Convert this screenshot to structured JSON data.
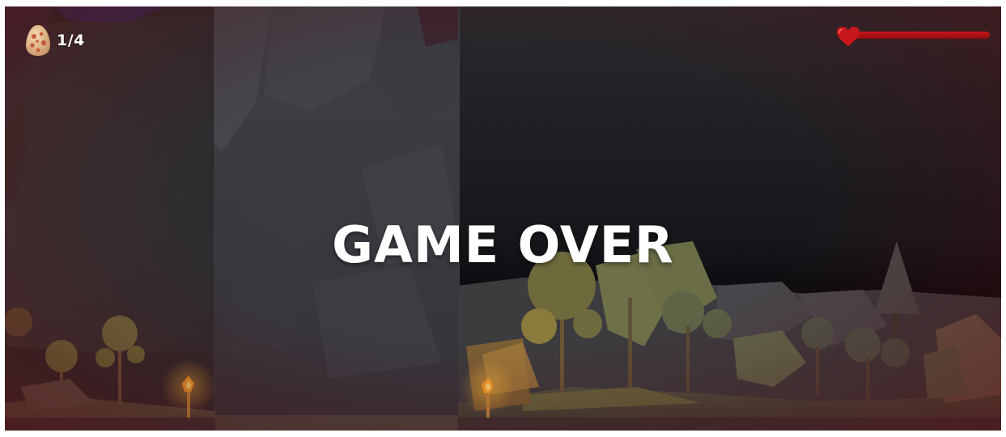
{
  "hud": {
    "eggs": {
      "count_text": "1/4",
      "icon": "spotted-egg-icon"
    },
    "health": {
      "icon": "heart-icon",
      "level_fraction": 1.0,
      "bar_color": "#b51217"
    }
  },
  "overlay": {
    "title": "GAME OVER",
    "vignette_color": "#5a0e12"
  }
}
